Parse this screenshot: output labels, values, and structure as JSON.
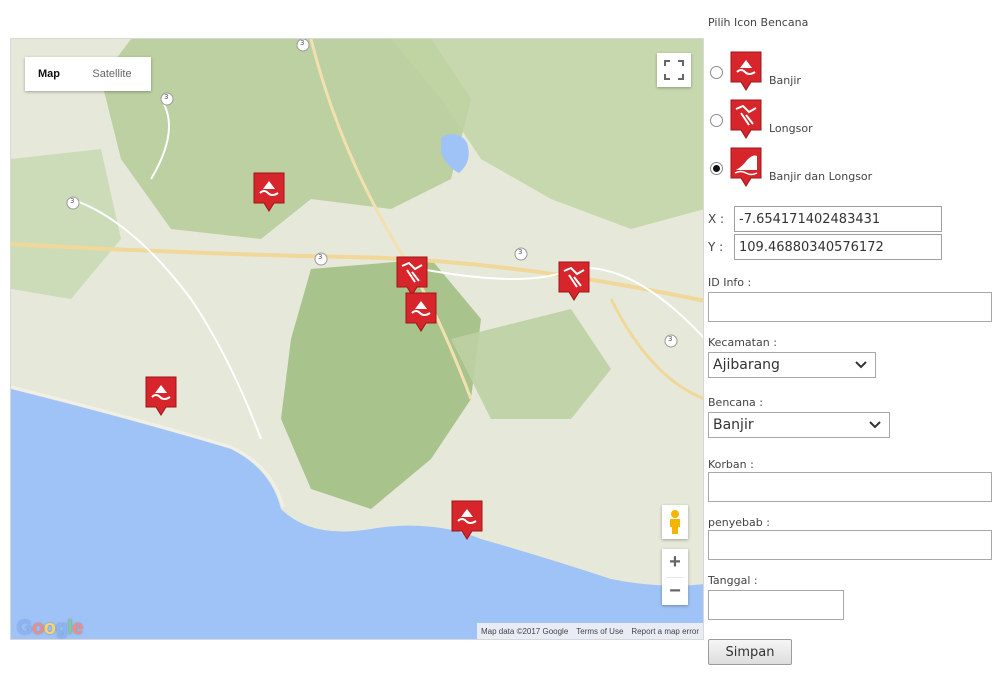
{
  "map": {
    "type_buttons": {
      "map": "Map",
      "satellite": "Satellite"
    },
    "logo": {
      "g": "G",
      "o1": "o",
      "o2": "o",
      "g2": "g",
      "l": "l",
      "e": "e"
    },
    "attribution": {
      "data": "Map data ©2017 Google",
      "terms": "Terms of Use",
      "report": "Report a map error"
    },
    "road_badges": [
      "3",
      "3",
      "3",
      "3",
      "3",
      "3"
    ],
    "markers": [
      {
        "name": "marker-banjir-1",
        "icon": "flood-icon"
      },
      {
        "name": "marker-longsor-1",
        "icon": "landslide-icon"
      },
      {
        "name": "marker-banjir-2",
        "icon": "flood-icon"
      },
      {
        "name": "marker-longsor-2",
        "icon": "landslide-icon"
      },
      {
        "name": "marker-banjir-3",
        "icon": "flood-icon"
      },
      {
        "name": "marker-banjir-4",
        "icon": "flood-icon"
      }
    ],
    "colors": {
      "water": "#9fc3f6",
      "land": "#e6e8da",
      "forest": "#a9c38c",
      "road": "#f1d79a",
      "marker": "#d7262b"
    }
  },
  "panel": {
    "title": "Pilih Icon Bencana",
    "options": [
      {
        "label": "Banjir",
        "icon": "flood-icon",
        "checked": false
      },
      {
        "label": "Longsor",
        "icon": "landslide-icon",
        "checked": false
      },
      {
        "label": "Banjir dan Longsor",
        "icon": "flood-landslide-icon",
        "checked": true
      }
    ],
    "x_label": "X :",
    "x_value": "-7.654171402483431",
    "y_label": "Y :",
    "y_value": "109.46880340576172",
    "id_info_label": "ID Info :",
    "id_info_value": "",
    "kecamatan_label": "Kecamatan :",
    "kecamatan_value": "Ajibarang",
    "bencana_label": "Bencana :",
    "bencana_value": "Banjir",
    "korban_label": "Korban :",
    "korban_value": "",
    "penyebab_label": "penyebab :",
    "penyebab_value": "",
    "tanggal_label": "Tanggal :",
    "tanggal_value": "",
    "submit_label": "Simpan"
  }
}
